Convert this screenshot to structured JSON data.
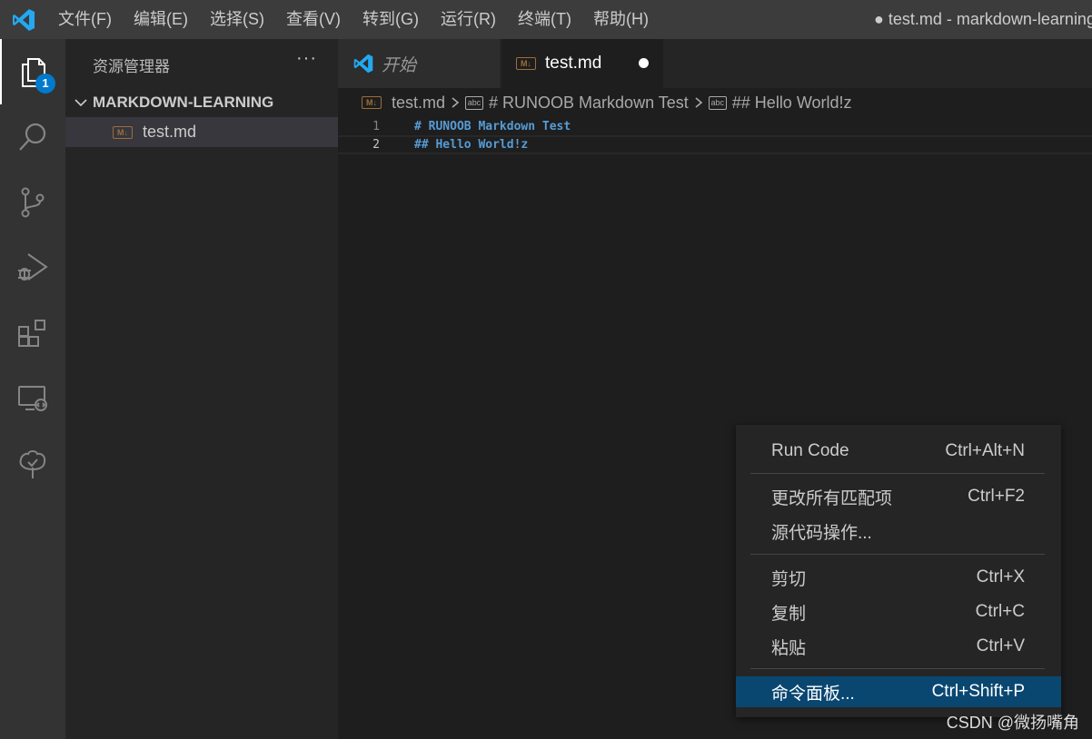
{
  "menubar": {
    "items": [
      "文件(F)",
      "编辑(E)",
      "选择(S)",
      "查看(V)",
      "转到(G)",
      "运行(R)",
      "终端(T)",
      "帮助(H)"
    ],
    "title": "● test.md - markdown-learning"
  },
  "activitybar": {
    "explorer_badge": "1",
    "icons": [
      "files-icon",
      "search-icon",
      "source-control-icon",
      "run-debug-icon",
      "extensions-icon",
      "remote-explorer-icon",
      "tree-icon"
    ]
  },
  "sidebar": {
    "header": "资源管理器",
    "more": "···",
    "folder": "MARKDOWN-LEARNING",
    "file": "test.md",
    "file_icon_text": "M↓"
  },
  "tabs": [
    {
      "label": "开始"
    },
    {
      "label": "test.md",
      "icon_text": "M↓"
    }
  ],
  "breadcrumb": {
    "file": "test.md",
    "file_icon_text": "M↓",
    "symbol_icon_text": "abc",
    "h1": "# RUNOOB Markdown Test",
    "h2": "## Hello World!z"
  },
  "editor": {
    "lines": [
      {
        "num": "1",
        "text": "# RUNOOB Markdown Test"
      },
      {
        "num": "2",
        "text": "## Hello World!z"
      }
    ]
  },
  "context_menu": {
    "items": [
      {
        "label": "Run Code",
        "shortcut": "Ctrl+Alt+N"
      },
      {
        "label": "更改所有匹配项",
        "shortcut": "Ctrl+F2"
      },
      {
        "label": "源代码操作...",
        "shortcut": ""
      },
      {
        "label": "剪切",
        "shortcut": "Ctrl+X"
      },
      {
        "label": "复制",
        "shortcut": "Ctrl+C"
      },
      {
        "label": "粘贴",
        "shortcut": "Ctrl+V"
      },
      {
        "label": "命令面板...",
        "shortcut": "Ctrl+Shift+P"
      }
    ],
    "selected_index": 6
  },
  "watermark": "CSDN @微扬嘴角",
  "colors": {
    "accent": "#007acc",
    "selection": "#094771",
    "markdown_heading": "#569cd6",
    "vscode_logo": "#23a9f2"
  }
}
